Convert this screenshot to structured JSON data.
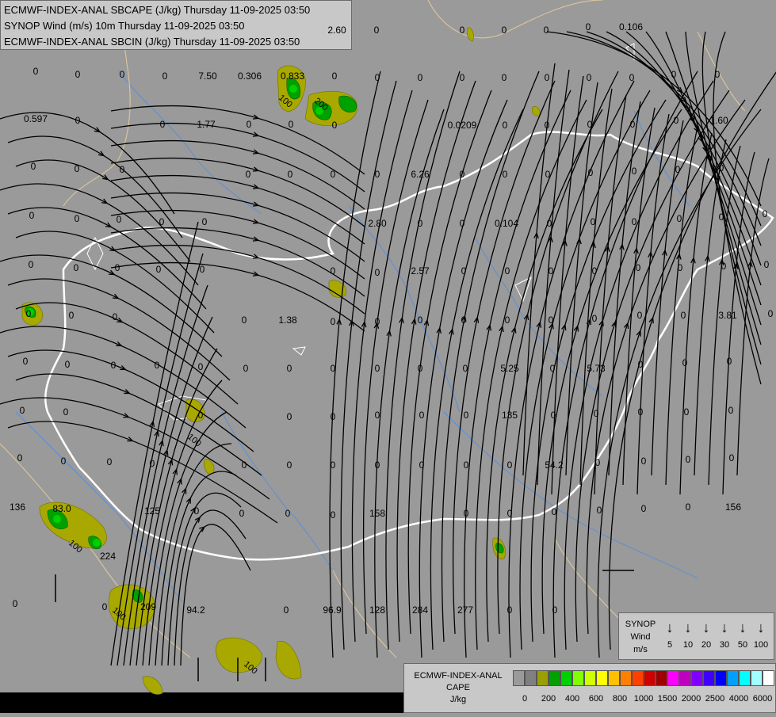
{
  "titles": [
    "ECMWF-INDEX-ANAL SBCAPE (J/kg) Thursday 11-09-2025 03:50",
    "SYNOP Wind (m/s) 10m Thursday 11-09-2025 03:50",
    "ECMWF-INDEX-ANAL SBCIN (J/kg) Thursday 11-09-2025 03:50"
  ],
  "map_values": [
    "0",
    "2.60",
    "0",
    "0",
    "0",
    "0",
    "0.106",
    "0",
    "7.50",
    "0.306",
    "0.833",
    "0",
    "0",
    "0",
    "0",
    "0",
    "0",
    "0",
    "0",
    "0",
    "0",
    "0",
    "0",
    "0",
    "0",
    "1.77",
    "0",
    "0",
    "0",
    "0.0209",
    "0",
    "0",
    "0",
    "0",
    "0",
    "1.60",
    "0.597",
    "0",
    "0",
    "0",
    "0",
    "0",
    "6.26",
    "0",
    "0",
    "0",
    "0",
    "0",
    "0",
    "0",
    "0",
    "0",
    "0",
    "0",
    "0",
    "2.80",
    "0",
    "0",
    "0.104",
    "0",
    "0",
    "0",
    "0",
    "0",
    "0",
    "0",
    "0",
    "0",
    "0",
    "0",
    "2.57",
    "0",
    "0",
    "0",
    "0",
    "0",
    "0",
    "0",
    "0",
    "0",
    "0",
    "0",
    "0",
    "0",
    "0",
    "1.38",
    "0",
    "0",
    "0",
    "0",
    "0",
    "0",
    "0",
    "0",
    "0",
    "3.81",
    "0",
    "0",
    "0",
    "0",
    "0",
    "0",
    "0",
    "0",
    "0",
    "0",
    "0",
    "0",
    "0",
    "5.25",
    "0",
    "5.73",
    "0",
    "0",
    "0",
    "0",
    "0",
    "0",
    "0",
    "0",
    "0",
    "0",
    "0",
    "135",
    "0",
    "0",
    "0",
    "0",
    "0",
    "0",
    "0",
    "0",
    "0",
    "0",
    "0",
    "0",
    "0",
    "0",
    "54.2",
    "0",
    "0",
    "0",
    "0",
    "0",
    "0",
    "0",
    "0",
    "158",
    "0",
    "0",
    "0",
    "0",
    "0",
    "0",
    "156",
    "136",
    "83.0",
    "224",
    "125",
    "0",
    "0",
    "0",
    "0",
    "0",
    "0",
    "209",
    "94.2",
    "0",
    "96.9",
    "128",
    "284",
    "277",
    "0",
    "0"
  ],
  "cape_contour_labels": [
    "100",
    "200",
    "100",
    "100",
    "100",
    "100"
  ],
  "wind_legend": {
    "title_line1": "SYNOP",
    "title_line2": "Wind",
    "unit": "m/s",
    "speeds": [
      "5",
      "10",
      "20",
      "30",
      "50",
      "100"
    ]
  },
  "cape_legend": {
    "title_line1": "ECMWF-INDEX-ANAL",
    "title_line2": "CAPE",
    "unit": "J/kg",
    "labels": [
      "0",
      "200",
      "400",
      "600",
      "800",
      "1000",
      "1500",
      "2000",
      "2500",
      "4000",
      "6000"
    ],
    "colors": [
      "#9a9a9a",
      "#808080",
      "#9aa000",
      "#00a000",
      "#00d000",
      "#80ff00",
      "#d0ff00",
      "#ffff00",
      "#ffc000",
      "#ff8000",
      "#ff4000",
      "#d00000",
      "#a00000",
      "#ff00ff",
      "#c000c0",
      "#8000ff",
      "#4000ff",
      "#0000ff",
      "#00a0ff",
      "#00ffff",
      "#a0ffff",
      "#ffffff"
    ]
  },
  "colors": {
    "background": "#9a9a9a",
    "border": "#ffffff",
    "river": "#5b8fd6",
    "streamline": "#000000",
    "cape_low": "#a8a800",
    "cape_mid": "#00a000",
    "cape_high": "#00d000"
  }
}
